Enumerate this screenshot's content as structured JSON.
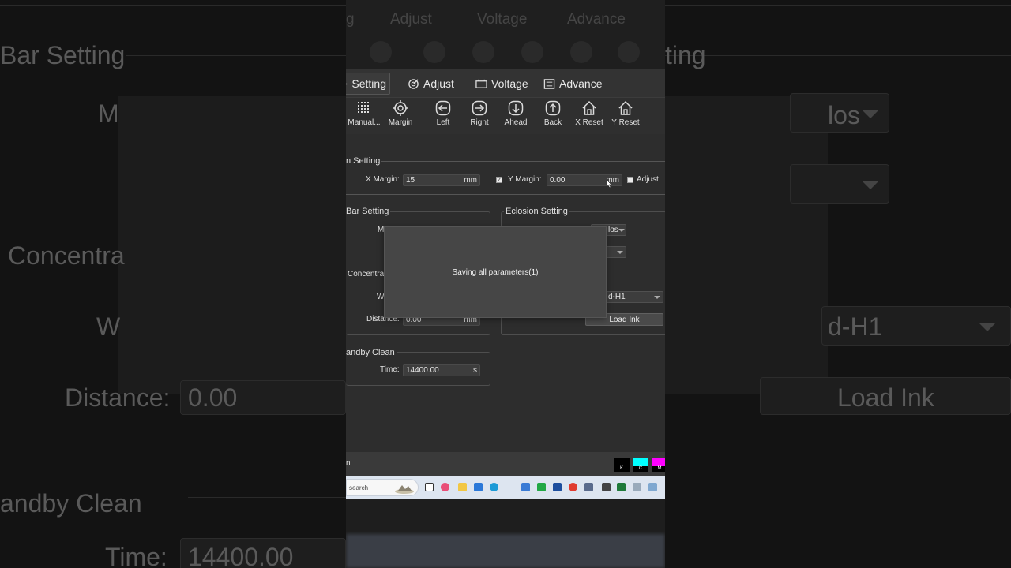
{
  "background": {
    "bar_setting": "Bar Setting",
    "ting": "ting",
    "m": "M",
    "concentra": "Concentra",
    "w": "W",
    "distance_label": "Distance:",
    "distance_value": "0.00",
    "andby_clean": "andby Clean",
    "time_label": "Time:",
    "time_value": "14400.00",
    "clos": "los",
    "d_h1": "d-H1",
    "load_ink": "Load Ink",
    "top_tabs": [
      "g",
      "Adjust",
      "Voltage",
      "Advance"
    ]
  },
  "tabs": [
    {
      "label": "Setting",
      "icon": "gear-icon",
      "active": true
    },
    {
      "label": "Adjust",
      "icon": "adjust-icon"
    },
    {
      "label": "Voltage",
      "icon": "battery-icon"
    },
    {
      "label": "Advance",
      "icon": "list-icon"
    }
  ],
  "toolbar": [
    {
      "label": "Manual...",
      "icon": "grid-icon"
    },
    {
      "label": "Margin",
      "icon": "crosshair-icon"
    },
    {
      "label": "Left",
      "icon": "arrow-left-icon"
    },
    {
      "label": "Right",
      "icon": "arrow-right-icon"
    },
    {
      "label": "Ahead",
      "icon": "arrow-down-icon"
    },
    {
      "label": "Back",
      "icon": "arrow-up-icon"
    },
    {
      "label": "X Reset",
      "icon": "home-icon"
    },
    {
      "label": "Y Reset",
      "icon": "home-icon"
    }
  ],
  "margin_setting": {
    "title": "n Setting",
    "x_label": "X Margin:",
    "x_value": "15",
    "x_unit": "mm",
    "y_label": "Y Margin:",
    "y_value": "0.00",
    "y_unit": "mm",
    "adjust_label": "Adjust"
  },
  "bar_setting": {
    "title": "Bar Setting",
    "m_label": "M",
    "concentra_label": "Concentra",
    "w_label": "W",
    "distance_label": "Distance:",
    "distance_value": "0.00",
    "distance_unit": "mm"
  },
  "eclosion_setting": {
    "title": "Eclosion Setting",
    "combo1": "los",
    "combo3": "d-H1",
    "load_ink": "Load Ink"
  },
  "standby_clean": {
    "title": "andby Clean",
    "time_label": "Time:",
    "time_value": "14400.00",
    "time_unit": "s"
  },
  "dialog": {
    "message": "Saving all parameters(1)"
  },
  "status": {
    "text": "n",
    "inks": [
      {
        "label": "K",
        "color": "#000000"
      },
      {
        "label": "C",
        "color": "#00ffff"
      },
      {
        "label": "M",
        "color": "#ff00ff"
      }
    ]
  },
  "taskbar": {
    "search_text": "search"
  }
}
